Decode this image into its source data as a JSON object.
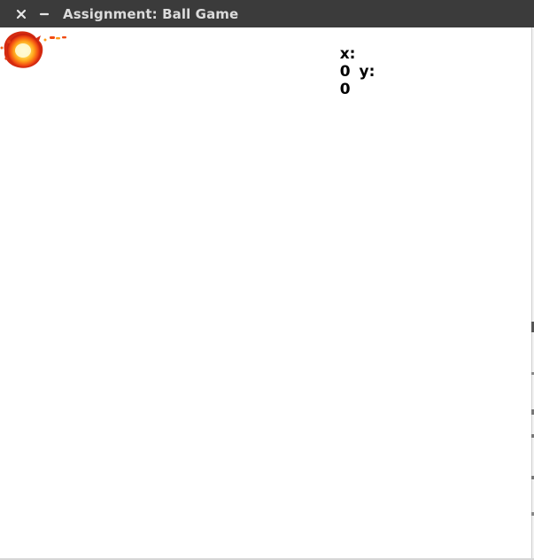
{
  "window": {
    "title": "Assignment: Ball Game",
    "close_icon": "close-icon",
    "minimize_icon": "minimize-icon"
  },
  "game": {
    "ball_icon": "fireball-icon",
    "coords": {
      "x_label": "x:",
      "x_value": "0",
      "y_label": "y:",
      "y_value": "0"
    }
  },
  "colors": {
    "titlebar": "#3b3b3b",
    "title_text": "#dcdcdc",
    "canvas": "#ffffff"
  }
}
